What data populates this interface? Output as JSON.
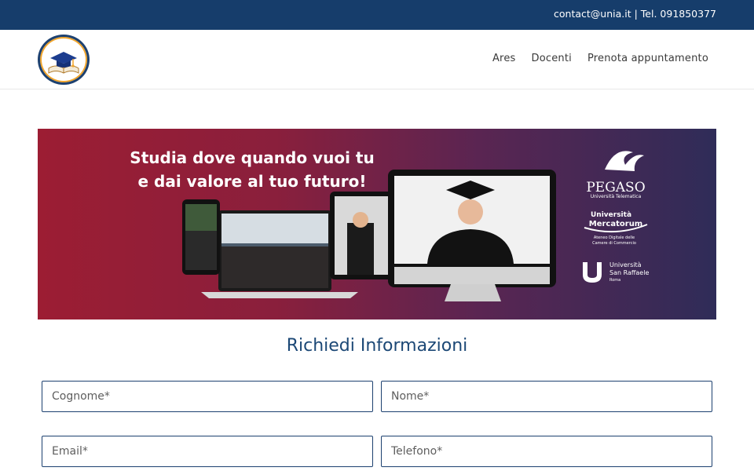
{
  "topbar": {
    "contact": "contact@unia.it | Tel. 091850377"
  },
  "header": {
    "logo_icon": "graduation-cap-book-icon",
    "nav": [
      {
        "label": "Ares"
      },
      {
        "label": "Docenti"
      },
      {
        "label": "Prenota appuntamento"
      }
    ]
  },
  "banner": {
    "headline_line1": "Studia dove quando vuoi tu",
    "headline_line2": "e dai valore al tuo futuro!",
    "partners": [
      {
        "name": "PEGASO",
        "subtitle": "Università Telematica"
      },
      {
        "name": "Università Mercatorum",
        "subtitle": "Ateneo Digitale delle Camere di Commercio"
      },
      {
        "name": "Università San Raffaele",
        "subtitle": "Roma"
      }
    ]
  },
  "form": {
    "title": "Richiedi Informazioni",
    "fields": [
      {
        "placeholder": "Cognome*"
      },
      {
        "placeholder": "Nome*"
      },
      {
        "placeholder": "Email*"
      },
      {
        "placeholder": "Telefono*"
      }
    ]
  },
  "colors": {
    "topbar": "#163d6b",
    "accent": "#1c4876",
    "banner_left": "#9c1d33",
    "banner_right": "#2f2c58"
  }
}
